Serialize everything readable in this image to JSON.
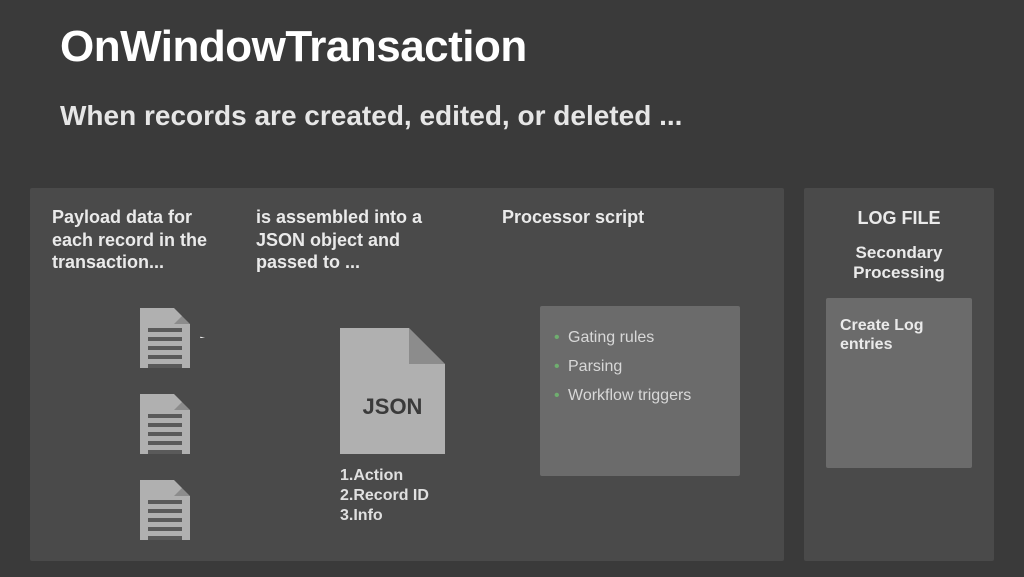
{
  "title": "OnWindowTransaction",
  "subtitle": "When records are created, edited, or deleted ...",
  "left_panel": {
    "col1_heading": "Payload data for each record in the transaction...",
    "col2_heading": "is assembled into a JSON object and passed to ...",
    "col3_heading": "Processor script",
    "json_label": "JSON",
    "json_fields": {
      "line1": "1.Action",
      "line2": "2.Record ID",
      "line3": "3.Info"
    },
    "processor_items": [
      "Gating rules",
      "Parsing",
      "Workflow triggers"
    ]
  },
  "right_panel": {
    "title": "LOG FILE",
    "subtitle": "Secondary Processing",
    "box_text": "Create Log entries"
  }
}
